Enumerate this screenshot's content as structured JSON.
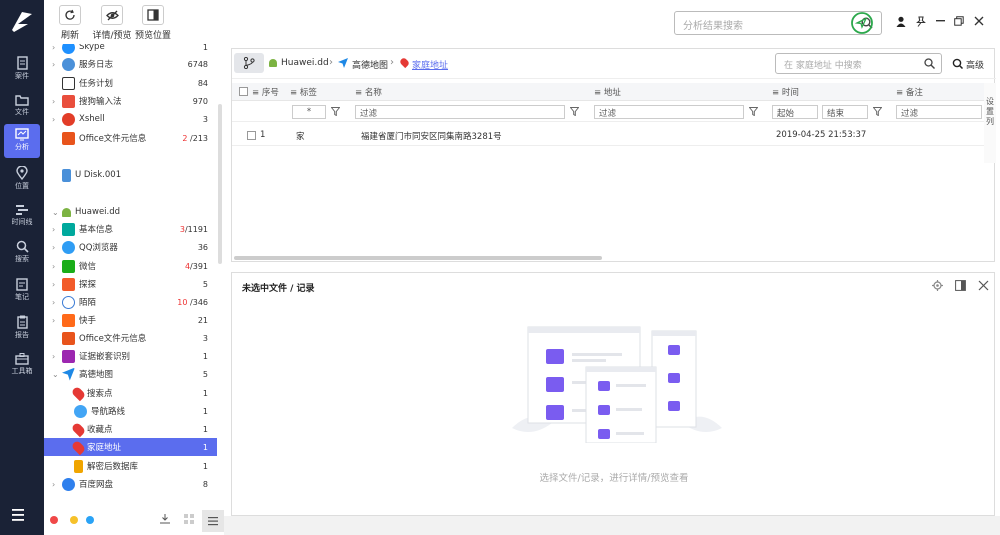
{
  "toolbar": {
    "refresh_label": "刷新",
    "detail_preview_label": "详情/预览",
    "preview_pos_label": "预览位置",
    "search_placeholder": "分析结果搜索"
  },
  "leftnav": [
    {
      "label": "案件",
      "icon": "case-icon"
    },
    {
      "label": "文件",
      "icon": "folder-icon"
    },
    {
      "label": "分析",
      "icon": "analysis-icon",
      "active": true
    },
    {
      "label": "位置",
      "icon": "location-icon"
    },
    {
      "label": "时间线",
      "icon": "timeline-icon"
    },
    {
      "label": "搜索",
      "icon": "search-icon"
    },
    {
      "label": "笔记",
      "icon": "note-icon"
    },
    {
      "label": "报告",
      "icon": "report-icon"
    },
    {
      "label": "工具箱",
      "icon": "toolbox-icon"
    }
  ],
  "tree": {
    "items": [
      {
        "label": "Skype",
        "count": "1",
        "color": "#1e90ff"
      },
      {
        "label": "服务日志",
        "count": "6748",
        "color": "#4a90d9"
      },
      {
        "label": "任务计划",
        "count": "84",
        "color": "#333333"
      },
      {
        "label": "搜狗输入法",
        "count": "970",
        "color": "#e94e3c"
      },
      {
        "label": "Xshell",
        "count": "3",
        "color": "#e23d28"
      },
      {
        "label": "Office文件元信息",
        "count_red": "2",
        "count": "/213",
        "color": "#e8541c"
      },
      {
        "label": "U Disk.001",
        "count": "",
        "color": "#4a90d9"
      },
      {
        "label": "Huawei.dd",
        "count": "",
        "color": "#7cb342"
      },
      {
        "label": "基本信息",
        "count_red": "3",
        "count": "/1191",
        "color": "#00a99d"
      },
      {
        "label": "QQ浏览器",
        "count": "36",
        "color": "#2f9df4"
      },
      {
        "label": "微信",
        "count_red": "4",
        "count": "/391",
        "color": "#1aad19"
      },
      {
        "label": "探探",
        "count": "5",
        "color": "#f25b2a"
      },
      {
        "label": "陌陌",
        "count_red": "10",
        "count": "/346",
        "color": "#3a7bd5"
      },
      {
        "label": "快手",
        "count": "21",
        "color": "#ff6a1a"
      },
      {
        "label": "Office文件元信息",
        "count": "3",
        "color": "#e8541c"
      },
      {
        "label": "证据嵌套识别",
        "count": "1",
        "color": "#9c27b0"
      },
      {
        "label": "高德地图",
        "count": "5",
        "color": "#1e88e5"
      },
      {
        "label": "搜索点",
        "count": "1",
        "color": "#e53935"
      },
      {
        "label": "导航路线",
        "count": "1",
        "color": "#42a5f5"
      },
      {
        "label": "收藏点",
        "count": "1",
        "color": "#e53935"
      },
      {
        "label": "家庭地址",
        "count": "1",
        "color": "#e53935",
        "selected": true
      },
      {
        "label": "解密后数据库",
        "count": "1",
        "color": "#f0a500"
      },
      {
        "label": "百度网盘",
        "count": "8",
        "color": "#2f80ed"
      }
    ]
  },
  "breadcrumb": {
    "device": "Huawei.dd",
    "app": "高德地图",
    "current": "家庭地址",
    "search_placeholder": "在 家庭地址 中搜索",
    "advanced_label": "高级"
  },
  "grid": {
    "columns": [
      "序号",
      "标签",
      "名称",
      "地址",
      "时间",
      "备注"
    ],
    "filters": {
      "tag_value": "*",
      "name_placeholder": "过滤",
      "address_placeholder": "过滤",
      "time_start": "起始",
      "time_end": "结束",
      "note_placeholder": "过滤"
    },
    "rows": [
      {
        "index": "1",
        "tag": "家",
        "name": "福建省厦门市同安区同集南路3281号",
        "address": "",
        "time": "2019-04-25 21:53:37",
        "note": ""
      }
    ],
    "column_settings": "设置列"
  },
  "detail": {
    "title": "未选中文件 / 记录",
    "hint": "选择文件/记录，进行详情/预览查看"
  },
  "colors": {
    "accent": "#5b6dee",
    "sidebar_bg": "#1a2236",
    "illustration_purple": "#7a5cf0"
  }
}
